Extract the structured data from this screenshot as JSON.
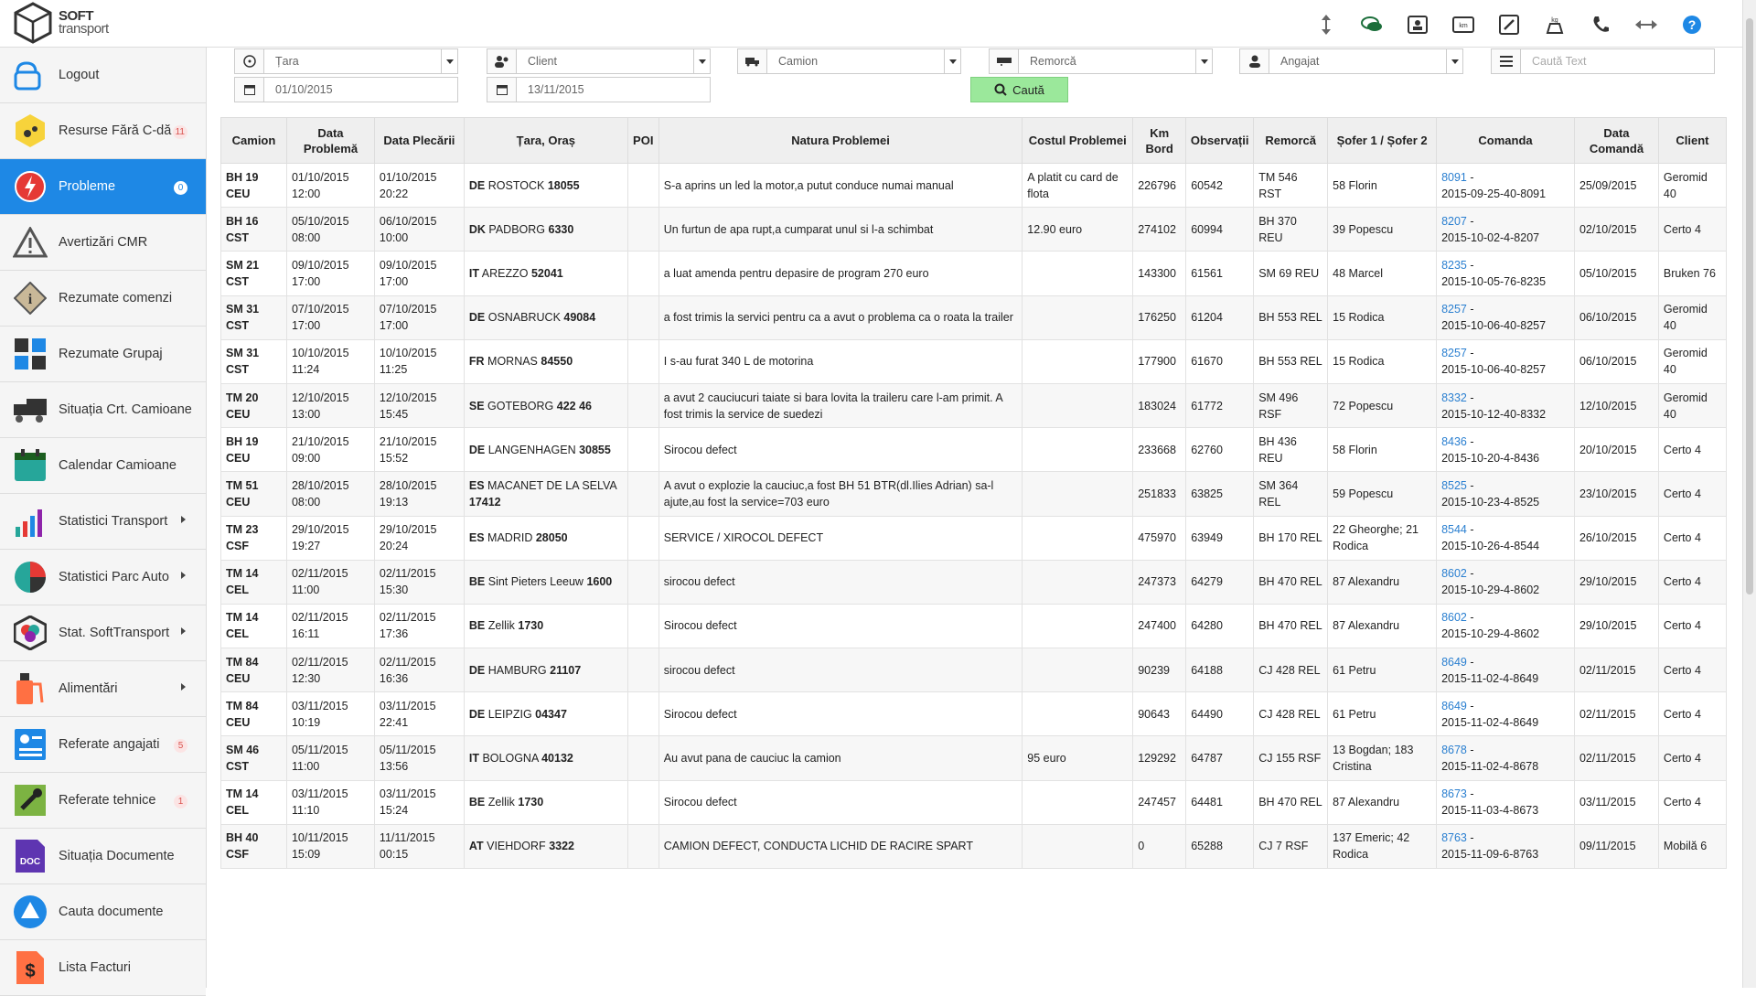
{
  "app": {
    "brand_line1": "SOFT",
    "brand_line2": "transport"
  },
  "topbar_icons": [
    "resize-vertical-icon",
    "chat-icon",
    "contact-card-icon",
    "km-icon",
    "tools-icon",
    "scale-icon",
    "phone-icon",
    "resize-horizontal-icon",
    "help-icon"
  ],
  "sidebar": {
    "items": [
      {
        "label": "Logout",
        "icon": "logout-icon",
        "badge": "",
        "arrow": false,
        "active": false
      },
      {
        "label": "Resurse Fără C-dă",
        "icon": "resources-icon",
        "badge": "11",
        "arrow": false,
        "active": false
      },
      {
        "label": "Probleme",
        "icon": "problems-icon",
        "badge": "0",
        "arrow": false,
        "active": true
      },
      {
        "label": "Avertizări CMR",
        "icon": "warning-icon",
        "badge": "",
        "arrow": false,
        "active": false
      },
      {
        "label": "Rezumate comenzi",
        "icon": "info-icon",
        "badge": "",
        "arrow": false,
        "active": false
      },
      {
        "label": "Rezumate Grupaj",
        "icon": "grid-icon",
        "badge": "",
        "arrow": false,
        "active": false
      },
      {
        "label": "Situația Crt. Camioane",
        "icon": "truck-icon",
        "badge": "",
        "arrow": false,
        "active": false
      },
      {
        "label": "Calendar Camioane",
        "icon": "calendar-icon",
        "badge": "",
        "arrow": false,
        "active": false
      },
      {
        "label": "Statistici Transport",
        "icon": "chart-icon",
        "badge": "",
        "arrow": true,
        "active": false
      },
      {
        "label": "Statistici Parc Auto",
        "icon": "pie-icon",
        "badge": "",
        "arrow": true,
        "active": false
      },
      {
        "label": "Stat. SoftTransport",
        "icon": "hexagon-icon",
        "badge": "",
        "arrow": true,
        "active": false
      },
      {
        "label": "Alimentări",
        "icon": "fuel-icon",
        "badge": "",
        "arrow": true,
        "active": false
      },
      {
        "label": "Referate angajati",
        "icon": "document-list-icon",
        "badge": "5",
        "arrow": false,
        "active": false
      },
      {
        "label": "Referate tehnice",
        "icon": "wrench-icon",
        "badge": "1",
        "arrow": false,
        "active": false
      },
      {
        "label": "Situația Documente",
        "icon": "doc-icon",
        "badge": "",
        "arrow": false,
        "active": false
      },
      {
        "label": "Cauta documente",
        "icon": "drive-icon",
        "badge": "",
        "arrow": false,
        "active": false
      },
      {
        "label": "Lista Facturi",
        "icon": "invoice-icon",
        "badge": "",
        "arrow": false,
        "active": false
      }
    ]
  },
  "filters": {
    "tara": "Țara",
    "client": "Client",
    "camion": "Camion",
    "remorca": "Remorcă",
    "angajat": "Angajat",
    "search_placeholder": "Caută Text",
    "date_from": "01/10/2015",
    "date_to": "13/11/2015",
    "search_button": "Caută"
  },
  "table": {
    "headers": [
      "Camion",
      "Data Problemă",
      "Data Plecării",
      "Țara, Oraș",
      "POI",
      "Natura Problemei",
      "Costul Problemei",
      "Km Bord",
      "Observații",
      "Remorcă",
      "Șofer 1 / Șofer 2",
      "Comanda",
      "Data Comandă",
      "Client"
    ],
    "rows": [
      {
        "camion": "BH 19 CEU",
        "data_problema": "01/10/2015 12:00",
        "data_plecarii": "01/10/2015 20:22",
        "tara": "DE",
        "oras": "ROSTOCK",
        "cp": "18055",
        "poi": "",
        "natura": "S-a aprins un led la motor,a putut conduce numai manual",
        "cost": "A platit cu card de flota",
        "km": "226796",
        "obs": "60542",
        "remorca": "TM 546 RST",
        "sofer": "58 Florin",
        "cmd_nr": "8091",
        "cmd_ref": "2015-09-25-40-8091",
        "data_cmd": "25/09/2015",
        "client": "Geromid 40"
      },
      {
        "camion": "BH 16 CST",
        "data_problema": "05/10/2015 08:00",
        "data_plecarii": "06/10/2015 10:00",
        "tara": "DK",
        "oras": "PADBORG",
        "cp": "6330",
        "poi": "",
        "natura": "Un furtun de apa rupt,a cumparat unul si l-a schimbat",
        "cost": "12.90 euro",
        "km": "274102",
        "obs": "60994",
        "remorca": "BH 370 REU",
        "sofer": "39 Popescu",
        "cmd_nr": "8207",
        "cmd_ref": "2015-10-02-4-8207",
        "data_cmd": "02/10/2015",
        "client": "Certo 4"
      },
      {
        "camion": "SM 21 CST",
        "data_problema": "09/10/2015 17:00",
        "data_plecarii": "09/10/2015 17:00",
        "tara": "IT",
        "oras": "AREZZO",
        "cp": "52041",
        "poi": "",
        "natura": "a luat amenda pentru depasire de program 270 euro",
        "cost": "",
        "km": "143300",
        "obs": "61561",
        "remorca": "SM 69 REU",
        "sofer": "48 Marcel",
        "cmd_nr": "8235",
        "cmd_ref": "2015-10-05-76-8235",
        "data_cmd": "05/10/2015",
        "client": "Bruken 76"
      },
      {
        "camion": "SM 31 CST",
        "data_problema": "07/10/2015 17:00",
        "data_plecarii": "07/10/2015 17:00",
        "tara": "DE",
        "oras": "OSNABRUCK",
        "cp": "49084",
        "poi": "",
        "natura": "a fost trimis la servici pentru ca a avut o problema ca o roata la trailer",
        "cost": "",
        "km": "176250",
        "obs": "61204",
        "remorca": "BH 553 REL",
        "sofer": "15 Rodica",
        "cmd_nr": "8257",
        "cmd_ref": "2015-10-06-40-8257",
        "data_cmd": "06/10/2015",
        "client": "Geromid 40"
      },
      {
        "camion": "SM 31 CST",
        "data_problema": "10/10/2015 11:24",
        "data_plecarii": "10/10/2015 11:25",
        "tara": "FR",
        "oras": "MORNAS",
        "cp": "84550",
        "poi": "",
        "natura": "I s-au furat 340 L de motorina",
        "cost": "",
        "km": "177900",
        "obs": "61670",
        "remorca": "BH 553 REL",
        "sofer": "15 Rodica",
        "cmd_nr": "8257",
        "cmd_ref": "2015-10-06-40-8257",
        "data_cmd": "06/10/2015",
        "client": "Geromid 40"
      },
      {
        "camion": "TM 20 CEU",
        "data_problema": "12/10/2015 13:00",
        "data_plecarii": "12/10/2015 15:45",
        "tara": "SE",
        "oras": "GOTEBORG",
        "cp": "422 46",
        "poi": "",
        "natura": "a avut 2 cauciucuri taiate si bara lovita la traileru care l-am primit. A fost trimis la service de suedezi",
        "cost": "",
        "km": "183024",
        "obs": "61772",
        "remorca": "SM 496 RSF",
        "sofer": "72 Popescu",
        "cmd_nr": "8332",
        "cmd_ref": "2015-10-12-40-8332",
        "data_cmd": "12/10/2015",
        "client": "Geromid 40"
      },
      {
        "camion": "BH 19 CEU",
        "data_problema": "21/10/2015 09:00",
        "data_plecarii": "21/10/2015 15:52",
        "tara": "DE",
        "oras": "LANGENHAGEN",
        "cp": "30855",
        "poi": "",
        "natura": "Sirocou defect",
        "cost": "",
        "km": "233668",
        "obs": "62760",
        "remorca": "BH 436 REU",
        "sofer": "58 Florin",
        "cmd_nr": "8436",
        "cmd_ref": "2015-10-20-4-8436",
        "data_cmd": "20/10/2015",
        "client": "Certo 4"
      },
      {
        "camion": "TM 51 CEU",
        "data_problema": "28/10/2015 08:00",
        "data_plecarii": "28/10/2015 19:13",
        "tara": "ES",
        "oras": "MACANET DE LA SELVA",
        "cp": "17412",
        "poi": "",
        "natura": "A avut o explozie la cauciuc,a fost BH 51 BTR(dl.Ilies Adrian) sa-l ajute,au fost la service=703 euro",
        "cost": "",
        "km": "251833",
        "obs": "63825",
        "remorca": "SM 364 REL",
        "sofer": "59 Popescu",
        "cmd_nr": "8525",
        "cmd_ref": "2015-10-23-4-8525",
        "data_cmd": "23/10/2015",
        "client": "Certo 4"
      },
      {
        "camion": "TM 23 CSF",
        "data_problema": "29/10/2015 19:27",
        "data_plecarii": "29/10/2015 20:24",
        "tara": "ES",
        "oras": "MADRID",
        "cp": "28050",
        "poi": "",
        "natura": "SERVICE / XIROCOL DEFECT",
        "cost": "",
        "km": "475970",
        "obs": "63949",
        "remorca": "BH 170 REL",
        "sofer": "22 Gheorghe; 21 Rodica",
        "cmd_nr": "8544",
        "cmd_ref": "2015-10-26-4-8544",
        "data_cmd": "26/10/2015",
        "client": "Certo 4"
      },
      {
        "camion": "TM 14 CEL",
        "data_problema": "02/11/2015 11:00",
        "data_plecarii": "02/11/2015 15:30",
        "tara": "BE",
        "oras": "Sint Pieters Leeuw",
        "cp": "1600",
        "poi": "",
        "natura": "sirocou defect",
        "cost": "",
        "km": "247373",
        "obs": "64279",
        "remorca": "BH 470 REL",
        "sofer": "87 Alexandru",
        "cmd_nr": "8602",
        "cmd_ref": "2015-10-29-4-8602",
        "data_cmd": "29/10/2015",
        "client": "Certo 4"
      },
      {
        "camion": "TM 14 CEL",
        "data_problema": "02/11/2015 16:11",
        "data_plecarii": "02/11/2015 17:36",
        "tara": "BE",
        "oras": "Zellik",
        "cp": "1730",
        "poi": "",
        "natura": "Sirocou defect",
        "cost": "",
        "km": "247400",
        "obs": "64280",
        "remorca": "BH 470 REL",
        "sofer": "87 Alexandru",
        "cmd_nr": "8602",
        "cmd_ref": "2015-10-29-4-8602",
        "data_cmd": "29/10/2015",
        "client": "Certo 4"
      },
      {
        "camion": "TM 84 CEU",
        "data_problema": "02/11/2015 12:30",
        "data_plecarii": "02/11/2015 16:36",
        "tara": "DE",
        "oras": "HAMBURG",
        "cp": "21107",
        "poi": "",
        "natura": "sirocou defect",
        "cost": "",
        "km": "90239",
        "obs": "64188",
        "remorca": "CJ 428 REL",
        "sofer": "61 Petru",
        "cmd_nr": "8649",
        "cmd_ref": "2015-11-02-4-8649",
        "data_cmd": "02/11/2015",
        "client": "Certo 4"
      },
      {
        "camion": "TM 84 CEU",
        "data_problema": "03/11/2015 10:19",
        "data_plecarii": "03/11/2015 22:41",
        "tara": "DE",
        "oras": "LEIPZIG",
        "cp": "04347",
        "poi": "",
        "natura": "Sirocou defect",
        "cost": "",
        "km": "90643",
        "obs": "64490",
        "remorca": "CJ 428 REL",
        "sofer": "61 Petru",
        "cmd_nr": "8649",
        "cmd_ref": "2015-11-02-4-8649",
        "data_cmd": "02/11/2015",
        "client": "Certo 4"
      },
      {
        "camion": "SM 46 CST",
        "data_problema": "05/11/2015 11:00",
        "data_plecarii": "05/11/2015 13:56",
        "tara": "IT",
        "oras": "BOLOGNA",
        "cp": "40132",
        "poi": "",
        "natura": "Au avut pana de cauciuc la camion",
        "cost": "95 euro",
        "km": "129292",
        "obs": "64787",
        "remorca": "CJ 155 RSF",
        "sofer": "13 Bogdan; 183 Cristina",
        "cmd_nr": "8678",
        "cmd_ref": "2015-11-02-4-8678",
        "data_cmd": "02/11/2015",
        "client": "Certo 4"
      },
      {
        "camion": "TM 14 CEL",
        "data_problema": "03/11/2015 11:10",
        "data_plecarii": "03/11/2015 15:24",
        "tara": "BE",
        "oras": "Zellik",
        "cp": "1730",
        "poi": "",
        "natura": "Sirocou defect",
        "cost": "",
        "km": "247457",
        "obs": "64481",
        "remorca": "BH 470 REL",
        "sofer": "87 Alexandru",
        "cmd_nr": "8673",
        "cmd_ref": "2015-11-03-4-8673",
        "data_cmd": "03/11/2015",
        "client": "Certo 4"
      },
      {
        "camion": "BH 40 CSF",
        "data_problema": "10/11/2015 15:09",
        "data_plecarii": "11/11/2015 00:15",
        "tara": "AT",
        "oras": "VIEHDORF",
        "cp": "3322",
        "poi": "",
        "natura": "CAMION DEFECT, CONDUCTA LICHID DE RACIRE SPART",
        "cost": "",
        "km": "0",
        "obs": "65288",
        "remorca": "CJ 7 RSF",
        "sofer": "137 Emeric; 42 Rodica",
        "cmd_nr": "8763",
        "cmd_ref": "2015-11-09-6-8763",
        "data_cmd": "09/11/2015",
        "client": "Mobilă 6"
      }
    ]
  },
  "colors": {
    "active": "#1e88e5",
    "search_button": "#9be89b",
    "link": "#2a7fd0",
    "badge_text": "#d9534f"
  }
}
